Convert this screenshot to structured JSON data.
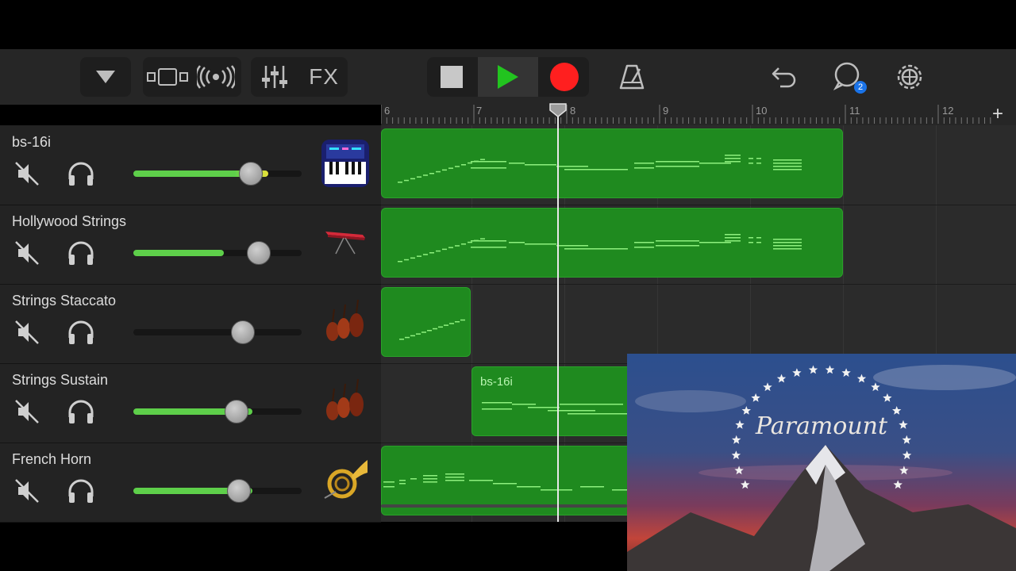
{
  "toolbar": {
    "fx_label": "FX",
    "notification_count": "2",
    "accent_play": "#22c41f",
    "accent_record": "#ff1f1f"
  },
  "ruler": {
    "bars": [
      "6",
      "7",
      "8",
      "9",
      "10",
      "11",
      "12"
    ],
    "add_label": "+"
  },
  "tracks": [
    {
      "name": "bs-16i",
      "volume": 0.69,
      "icon": "synth-keyboard-icon",
      "muted": true
    },
    {
      "name": "Hollywood Strings",
      "volume": 0.74,
      "icon": "red-keyboard-icon",
      "muted": true
    },
    {
      "name": "Strings Staccato",
      "volume": 0.65,
      "icon": "violin-section-icon",
      "muted": true
    },
    {
      "name": "Strings Sustain",
      "volume": 0.61,
      "icon": "violin-section-icon",
      "muted": true
    },
    {
      "name": "French Horn",
      "volume": 0.62,
      "icon": "french-horn-icon",
      "muted": true
    }
  ],
  "regions": {
    "strings_sustain_label": "bs-16i"
  },
  "video": {
    "logo_text": "Paramount"
  }
}
